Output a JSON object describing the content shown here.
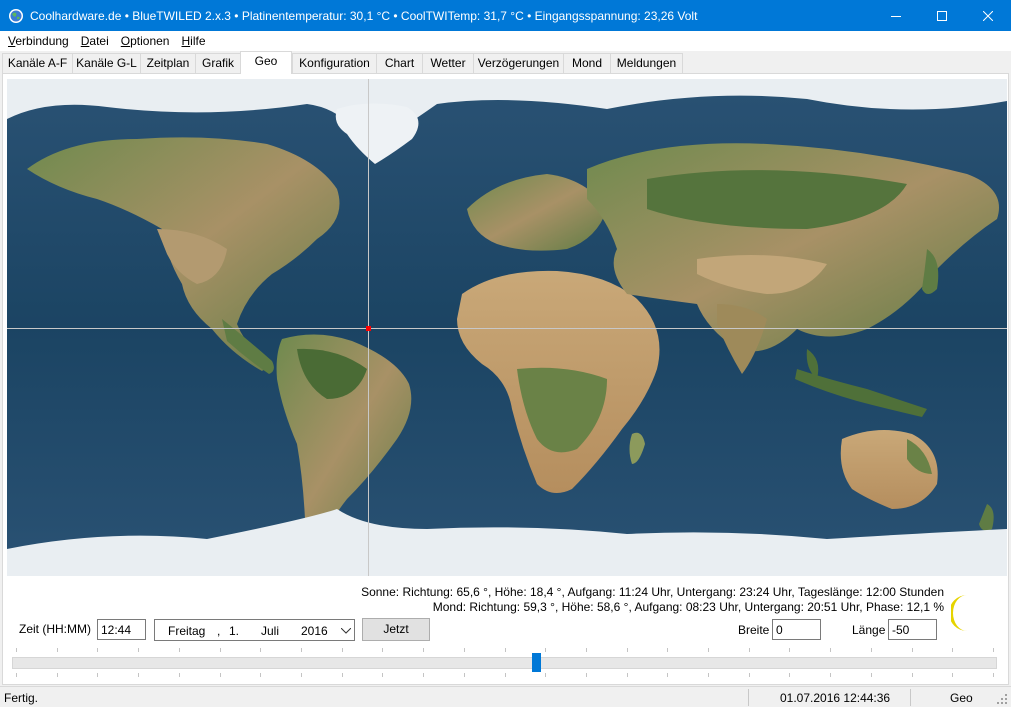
{
  "window": {
    "title": "Coolhardware.de • BlueTWILED 2.x.3 • Platinentemperatur: 30,1 °C • CoolTWITemp: 31,7 °C • Eingangsspannung: 23,26 Volt",
    "icon": "globe-icon"
  },
  "menu": [
    "Verbindung",
    "Datei",
    "Optionen",
    "Hilfe"
  ],
  "tabs": [
    "Kanäle A-F",
    "Kanäle G-L",
    "Zeitplan",
    "Grafik",
    "Geo",
    "Konfiguration",
    "Chart",
    "Wetter",
    "Verzögerungen",
    "Mond",
    "Meldungen"
  ],
  "active_tab": "Geo",
  "map": {
    "marker_color": "#ff0000",
    "crosshair_color": "#c8c8c8",
    "marker_latitude": 0,
    "marker_longitude": -50
  },
  "info": {
    "sun": "Sonne: Richtung: 65,6 °, Höhe: 18,4 °, Aufgang: 11:24 Uhr, Untergang: 23:24 Uhr, Tageslänge: 12:00 Stunden",
    "moon": "Mond: Richtung: 59,3 °, Höhe: 58,6 °, Aufgang: 08:23 Uhr, Untergang: 20:51 Uhr, Phase: 12,1 %",
    "moon_icon": "crescent-moon-icon"
  },
  "controls": {
    "time_label": "Zeit (HH:MM)",
    "time_value": "12:44",
    "date": {
      "weekday": "Freitag",
      "sep": ",",
      "day": "1.",
      "month": "Juli",
      "year": "2016"
    },
    "now_button": "Jetzt",
    "lat_label": "Breite",
    "lat_value": "0",
    "lon_label": "Länge",
    "lon_value": "-50"
  },
  "slider": {
    "value_fraction": 0.532
  },
  "status": {
    "text": "Fertig.",
    "datetime": "01.07.2016 12:44:36",
    "tab": "Geo"
  },
  "colors": {
    "accent": "#0078d7"
  }
}
